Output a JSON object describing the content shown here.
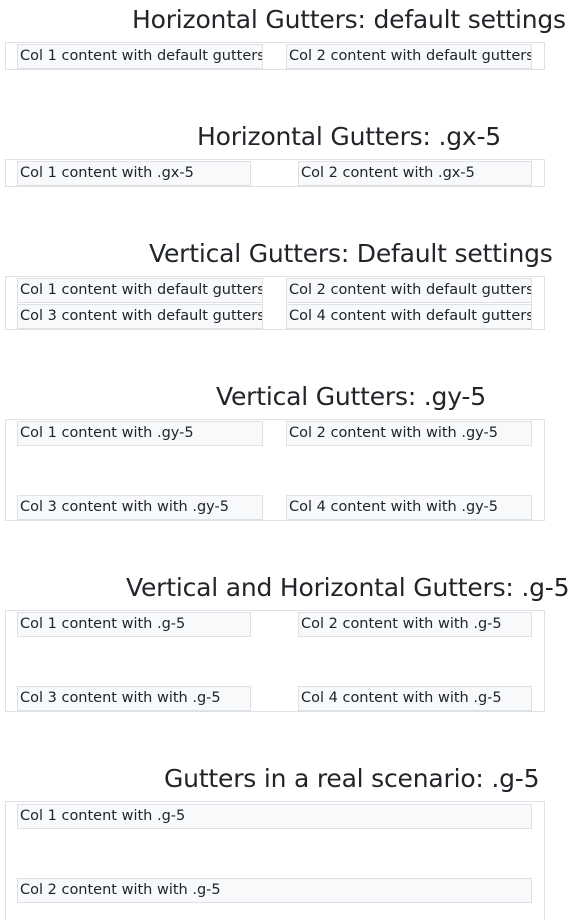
{
  "sections": [
    {
      "title": "Horizontal Gutters: default settings",
      "cells": [
        "Col 1 content with default gutters",
        "Col 2 content with default gutters"
      ]
    },
    {
      "title": "Horizontal Gutters: .gx-5",
      "cells": [
        "Col 1 content with .gx-5",
        "Col 2 content with .gx-5"
      ]
    },
    {
      "title": "Vertical Gutters: Default settings",
      "cells": [
        "Col 1 content with default gutters",
        "Col 2 content with default gutters",
        "Col 3 content with default gutters",
        "Col 4 content with default gutters"
      ]
    },
    {
      "title": "Vertical Gutters: .gy-5",
      "cells": [
        "Col 1 content with .gy-5",
        "Col 2 content with with .gy-5",
        "Col 3 content with with .gy-5",
        "Col 4 content with with .gy-5"
      ]
    },
    {
      "title": "Vertical and Horizontal Gutters: .g-5",
      "cells": [
        "Col 1 content with .g-5",
        "Col 2 content with with .g-5",
        "Col 3 content with with .g-5",
        "Col 4 content with with .g-5"
      ]
    },
    {
      "title": "Gutters in a real scenario: .g-5",
      "cells": [
        "Col 1 content with .g-5",
        "Col 2 content with with .g-5"
      ]
    }
  ]
}
